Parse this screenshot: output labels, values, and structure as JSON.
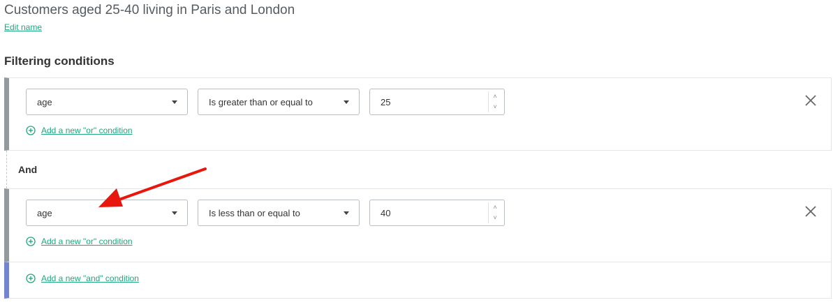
{
  "segment": {
    "name": "Customers aged 25-40 living in Paris and London",
    "edit_label": "Edit name"
  },
  "filtering": {
    "title": "Filtering conditions",
    "joiner_label": "And",
    "add_or_label": "Add a new \"or\" condition",
    "add_and_label": "Add a new \"and\" condition",
    "conditions": [
      {
        "field": "age",
        "operator": "Is greater than or equal to",
        "value": "25"
      },
      {
        "field": "age",
        "operator": "Is less than or equal to",
        "value": "40"
      }
    ]
  },
  "icons": {
    "add": "plus-circle-icon",
    "remove": "close-icon",
    "dropdown": "caret-down-icon",
    "spinner_up": "chevron-up-icon",
    "spinner_down": "chevron-down-icon"
  },
  "colors": {
    "link": "#1fa77e",
    "block_border": "#929a9d",
    "add_and_border": "#7484cf",
    "annotation_arrow": "#e8160c"
  }
}
